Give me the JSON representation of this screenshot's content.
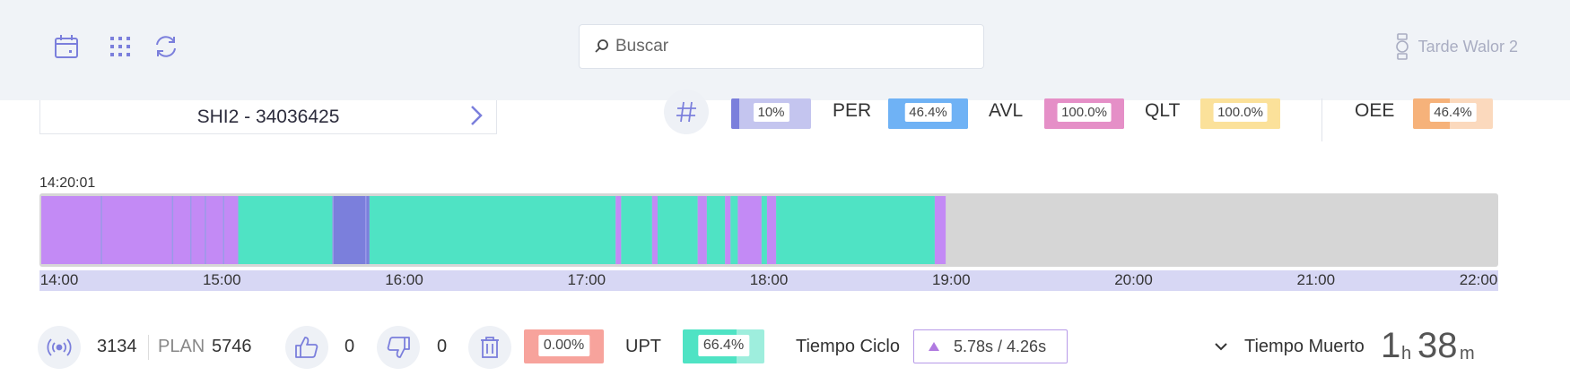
{
  "topbar": {
    "icons": [
      "calendar-icon",
      "grid-icon",
      "refresh-icon"
    ],
    "search_placeholder": "Buscar",
    "user_name": "Tarde Walor 2"
  },
  "machine": {
    "label": "SHI2 - 34036425"
  },
  "kpis": [
    {
      "label": "",
      "value": "10%",
      "fill_pct": 0.1,
      "color": "#7b7fdc",
      "bg": "#c4c5ef"
    },
    {
      "label": "PER",
      "value": "46.4%",
      "fill_pct": 1.0,
      "color": "#6fb2f5",
      "bg": "#6fb2f5"
    },
    {
      "label": "AVL",
      "value": "100.0%",
      "fill_pct": 1.0,
      "color": "#e58fc7",
      "bg": "#e58fc7"
    },
    {
      "label": "QLT",
      "value": "100.0%",
      "fill_pct": 1.0,
      "color": "#fbe19a",
      "bg": "#fbe19a"
    },
    {
      "label": "OEE",
      "value": "46.4%",
      "fill_pct": 0.464,
      "color": "#f6b27a",
      "bg": "#fbd9bd"
    }
  ],
  "timeline": {
    "start_time": "14:20:01",
    "ticks": [
      "14:00",
      "15:00",
      "16:00",
      "17:00",
      "18:00",
      "19:00",
      "20:00",
      "21:00",
      "22:00"
    ],
    "range_hours": [
      14,
      22
    ],
    "state_colors": {
      "stop": "#c38af5",
      "run": "#4fe3c4",
      "setup": "#7b7fdc",
      "empty": "#d6d6d6"
    },
    "segments": [
      {
        "state": "stop",
        "start": 14.0,
        "end": 15.08
      },
      {
        "state": "run",
        "start": 15.08,
        "end": 15.6
      },
      {
        "state": "setup",
        "start": 15.6,
        "end": 15.8
      },
      {
        "state": "run",
        "start": 15.8,
        "end": 17.15
      },
      {
        "state": "stop",
        "start": 17.15,
        "end": 17.18
      },
      {
        "state": "run",
        "start": 17.18,
        "end": 17.35
      },
      {
        "state": "stop",
        "start": 17.35,
        "end": 17.38
      },
      {
        "state": "run",
        "start": 17.38,
        "end": 17.6
      },
      {
        "state": "stop",
        "start": 17.6,
        "end": 17.65
      },
      {
        "state": "run",
        "start": 17.65,
        "end": 17.75
      },
      {
        "state": "stop",
        "start": 17.75,
        "end": 17.78
      },
      {
        "state": "run",
        "start": 17.78,
        "end": 17.82
      },
      {
        "state": "stop",
        "start": 17.82,
        "end": 17.95
      },
      {
        "state": "run",
        "start": 17.95,
        "end": 17.98
      },
      {
        "state": "stop",
        "start": 17.98,
        "end": 18.03
      },
      {
        "state": "run",
        "start": 18.03,
        "end": 18.9
      },
      {
        "state": "stop",
        "start": 18.9,
        "end": 18.96
      }
    ],
    "dividers": [
      14.33,
      14.72,
      14.82,
      14.9,
      15.0,
      15.6,
      15.78
    ]
  },
  "bottom": {
    "produced": "3134",
    "plan_label": "PLAN",
    "plan": "5746",
    "good": "0",
    "bad": "0",
    "scrap_pct": "0.00%",
    "scrap_color": "#f7a39c",
    "upt_label": "UPT",
    "upt_value": "66.4%",
    "upt_fill_pct": 0.664,
    "upt_color": "#4fe3c4",
    "upt_bg": "#9eeedd",
    "cycle_label": "Tiempo Ciclo",
    "cycle_value": "5.78s / 4.26s",
    "cycle_arrow_color": "#b07ae0",
    "dead_label": "Tiempo Muerto",
    "dead_hours": "1",
    "dead_hours_unit": "h",
    "dead_minutes": "38",
    "dead_minutes_unit": "m"
  }
}
